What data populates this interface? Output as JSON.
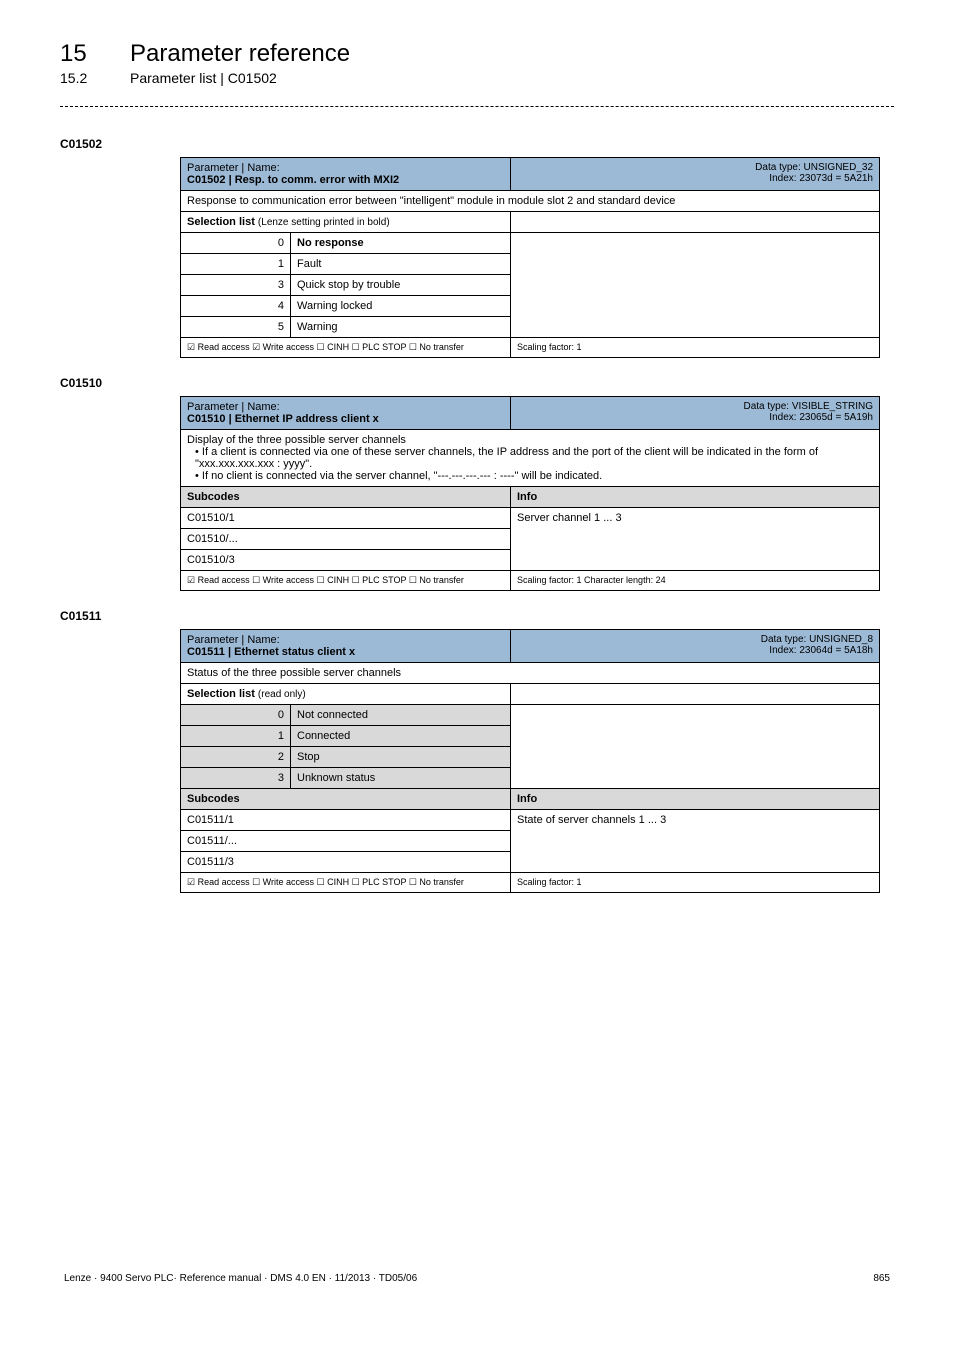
{
  "header": {
    "chapter_num": "15",
    "chapter_title": "Parameter reference",
    "sub_num": "15.2",
    "sub_title": "Parameter list | C01502"
  },
  "tables": {
    "t1": {
      "code": "C01502",
      "param_label": "Parameter | Name:",
      "param_name": "C01502 | Resp. to comm. error with MXI2",
      "data_type": "Data type: UNSIGNED_32",
      "index": "Index: 23073d = 5A21h",
      "desc": "Response to communication error between \"intelligent\" module in module slot 2 and standard device",
      "sel_label": "Selection list",
      "sel_sub": "(Lenze setting printed in bold)",
      "rows": [
        {
          "n": "0",
          "v": "No response",
          "bold": true
        },
        {
          "n": "1",
          "v": "Fault",
          "bold": false
        },
        {
          "n": "3",
          "v": "Quick stop by trouble",
          "bold": false
        },
        {
          "n": "4",
          "v": "Warning locked",
          "bold": false
        },
        {
          "n": "5",
          "v": "Warning",
          "bold": false
        }
      ],
      "foot_left": "☑ Read access   ☑ Write access   ☐ CINH   ☐ PLC STOP   ☐ No transfer",
      "foot_right": "Scaling factor: 1"
    },
    "t2": {
      "code": "C01510",
      "param_label": "Parameter | Name:",
      "param_name": "C01510 | Ethernet IP address client x",
      "data_type": "Data type: VISIBLE_STRING",
      "index": "Index: 23065d = 5A19h",
      "desc_line1": "Display of the three possible server channels",
      "desc_bullet1": "• If a client is connected via one of these server channels, the IP address and the port of the client will be indicated in the form of \"xxx.xxx.xxx.xxx : yyyy\".",
      "desc_bullet2": "• If no client is connected via the server channel, \"---.---.---.--- : ----\" will be indicated.",
      "subcodes_label": "Subcodes",
      "info_label": "Info",
      "rows": [
        {
          "sub": "C01510/1"
        },
        {
          "sub": "C01510/..."
        },
        {
          "sub": "C01510/3"
        }
      ],
      "info_val": "Server channel 1 ... 3",
      "foot_left": "☑ Read access   ☐ Write access   ☐ CINH   ☐ PLC STOP   ☐ No transfer",
      "foot_right": "Scaling factor: 1    Character length: 24"
    },
    "t3": {
      "code": "C01511",
      "param_label": "Parameter | Name:",
      "param_name": "C01511 | Ethernet status client x",
      "data_type": "Data type: UNSIGNED_8",
      "index": "Index: 23064d = 5A18h",
      "desc": "Status of the three possible server channels",
      "sel_label": "Selection list",
      "sel_sub": "(read only)",
      "sel_rows": [
        {
          "n": "0",
          "v": "Not connected"
        },
        {
          "n": "1",
          "v": "Connected"
        },
        {
          "n": "2",
          "v": "Stop"
        },
        {
          "n": "3",
          "v": "Unknown status"
        }
      ],
      "subcodes_label": "Subcodes",
      "info_label": "Info",
      "sub_rows": [
        {
          "sub": "C01511/1"
        },
        {
          "sub": "C01511/..."
        },
        {
          "sub": "C01511/3"
        }
      ],
      "info_val": "State of server channels 1 ... 3",
      "foot_left": "☑ Read access   ☐ Write access   ☐ CINH   ☐ PLC STOP   ☐ No transfer",
      "foot_right": "Scaling factor: 1"
    }
  },
  "footer": {
    "left": "Lenze · 9400 Servo PLC· Reference manual · DMS 4.0 EN · 11/2013 · TD05/06",
    "right": "865"
  }
}
